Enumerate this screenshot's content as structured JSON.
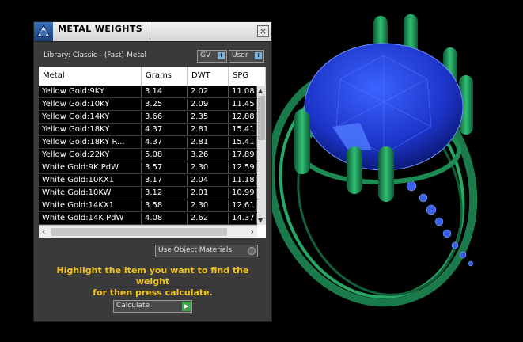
{
  "window": {
    "title": "METAL WEIGHTS",
    "close_label": "×"
  },
  "library": {
    "label": "Library: Classic - (Fast)-Metal"
  },
  "toggles": {
    "gv_label": "GV",
    "user_label": "User"
  },
  "table": {
    "columns": [
      "Metal",
      "Grams",
      "DWT",
      "SPG"
    ],
    "rows": [
      [
        "Yellow Gold:9KY",
        "3.14",
        "2.02",
        "11.08"
      ],
      [
        "Yellow Gold:10KY",
        "3.25",
        "2.09",
        "11.45"
      ],
      [
        "Yellow Gold:14KY",
        "3.66",
        "2.35",
        "12.88"
      ],
      [
        "Yellow Gold:18KY",
        "4.37",
        "2.81",
        "15.41"
      ],
      [
        "Yellow Gold:18KY R...",
        "4.37",
        "2.81",
        "15.41"
      ],
      [
        "Yellow Gold:22KY",
        "5.08",
        "3.26",
        "17.89"
      ],
      [
        "White Gold:9K PdW",
        "3.57",
        "2.30",
        "12.59"
      ],
      [
        "White Gold:10KX1",
        "3.17",
        "2.04",
        "11.18"
      ],
      [
        "White Gold:10KW",
        "3.12",
        "2.01",
        "10.99"
      ],
      [
        "White Gold:14KX1",
        "3.58",
        "2.30",
        "12.61"
      ],
      [
        "White Gold:14K PdW",
        "4.08",
        "2.62",
        "14.37"
      ]
    ]
  },
  "use_object_materials_label": "Use Object Materials",
  "hint": {
    "line1": "Highlight the item you want to find the weight",
    "line2": "for then press calculate."
  },
  "calculate_label": "Calculate",
  "colors": {
    "hint_text": "#f2c31a",
    "gem": "#1f3fd6",
    "metal": "#2fa86a",
    "go_button": "#3ba54a"
  }
}
